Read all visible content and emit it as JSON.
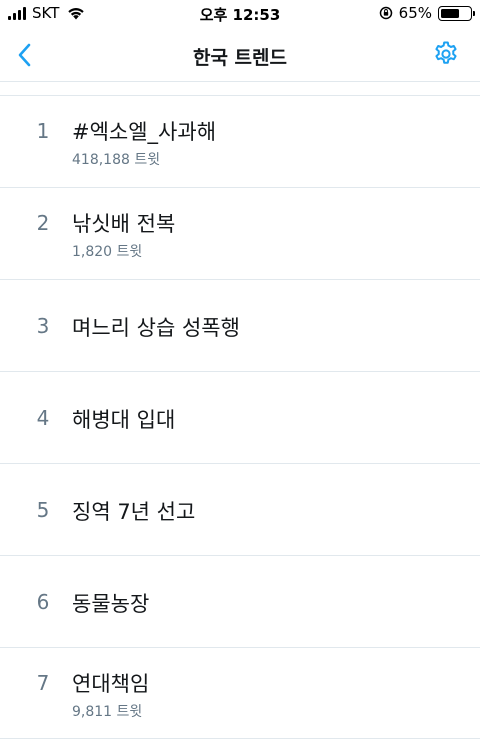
{
  "status_bar": {
    "carrier": "SKT",
    "time": "오후 12:53",
    "battery": "65%",
    "battery_level": 0.65
  },
  "nav": {
    "title": "한국 트렌드",
    "back_icon": "chevron-left-icon",
    "settings_icon": "gear-icon"
  },
  "trends": [
    {
      "rank": "1",
      "name": "#엑소엘_사과해",
      "count": "418,188 트윗"
    },
    {
      "rank": "2",
      "name": "낚싯배 전복",
      "count": "1,820 트윗"
    },
    {
      "rank": "3",
      "name": "며느리 상습 성폭행",
      "count": ""
    },
    {
      "rank": "4",
      "name": "해병대 입대",
      "count": ""
    },
    {
      "rank": "5",
      "name": "징역 7년 선고",
      "count": ""
    },
    {
      "rank": "6",
      "name": "동물농장",
      "count": ""
    },
    {
      "rank": "7",
      "name": "연대책임",
      "count": "9,811 트윗"
    }
  ],
  "colors": {
    "accent": "#1da1f2",
    "text_primary": "#14171a",
    "text_secondary": "#657786",
    "divider": "#e1e8ed"
  }
}
